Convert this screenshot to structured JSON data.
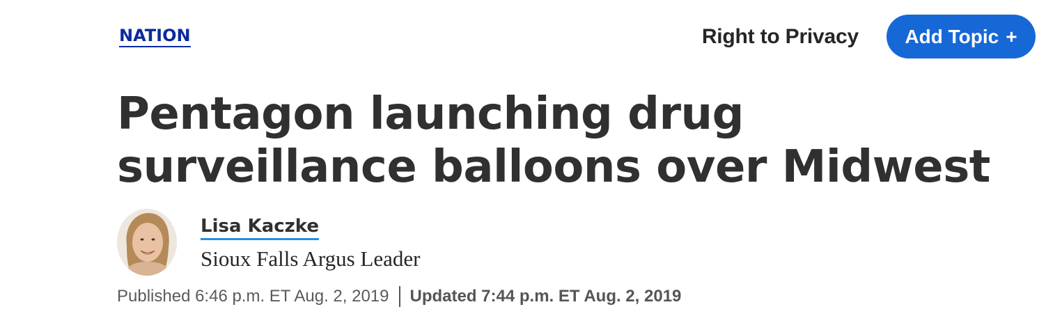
{
  "section": {
    "label": "NATION"
  },
  "topic": {
    "label": "Right to Privacy",
    "button_label": "Add Topic",
    "button_icon": "plus-icon",
    "button_color": "#1668d6"
  },
  "headline": {
    "line1": "Pentagon launching drug",
    "line2": "surveillance balloons over Midwest"
  },
  "author": {
    "name": "Lisa Kaczke",
    "organization": "Sioux Falls Argus Leader",
    "underline_color": "#1f8fe8"
  },
  "dateline": {
    "published": "Published 6:46 p.m. ET Aug. 2, 2019",
    "updated": "Updated 7:44 p.m. ET Aug. 2, 2019"
  },
  "colors": {
    "section_link": "#0b2a9e",
    "headline_text": "#303030"
  }
}
